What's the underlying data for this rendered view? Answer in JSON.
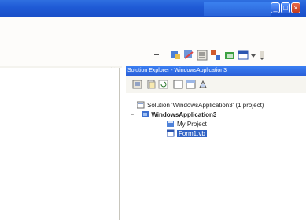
{
  "window": {
    "minimize_glyph": "_",
    "maximize_glyph": "□",
    "close_glyph": "×",
    "title_color": "#2a63d8"
  },
  "toolbar": {
    "icons": [
      "dropdown-icon",
      "find-icon",
      "find-in-files-icon",
      "properties-icon",
      "object-browser-icon",
      "toolbox-icon",
      "output-icon",
      "more-icon"
    ]
  },
  "document": {
    "close_glyph": "×",
    "menu_glyph": "▾"
  },
  "solution_explorer": {
    "title": "Solution Explorer - WindowsApplication3",
    "toolbar_icons": [
      "properties-icon",
      "show-all-files-icon",
      "refresh-icon",
      "view-code-icon",
      "view-designer-icon",
      "class-diagram-icon"
    ],
    "tree": {
      "solution": "Solution 'WindowsApplication3' (1 project)",
      "project": "WindowsApplication3",
      "my_project": "My Project",
      "form": "Form1.vb"
    }
  }
}
